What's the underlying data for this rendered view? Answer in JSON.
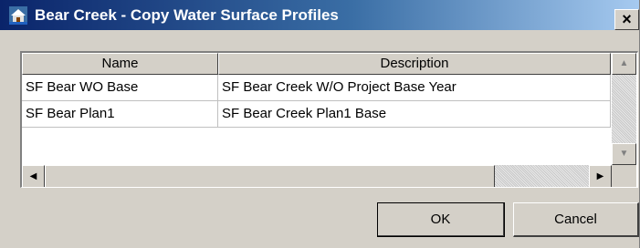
{
  "window": {
    "title": "Bear Creek - Copy Water Surface Profiles",
    "icon": "hecras-app-icon",
    "close_glyph": "×"
  },
  "table": {
    "columns": [
      "Name",
      "Description"
    ],
    "rows": [
      {
        "name": "SF Bear WO Base",
        "description": "SF Bear Creek  W/O Project Base Year"
      },
      {
        "name": "SF Bear Plan1",
        "description": "SF Bear Creek Plan1 Base"
      }
    ]
  },
  "scrollbars": {
    "up_glyph": "▲",
    "down_glyph": "▼",
    "left_glyph": "◀",
    "right_glyph": "▶"
  },
  "buttons": {
    "ok": "OK",
    "cancel": "Cancel"
  },
  "colors": {
    "title_start": "#0a246a",
    "title_end": "#a6caf0",
    "face": "#d4d0c8"
  }
}
